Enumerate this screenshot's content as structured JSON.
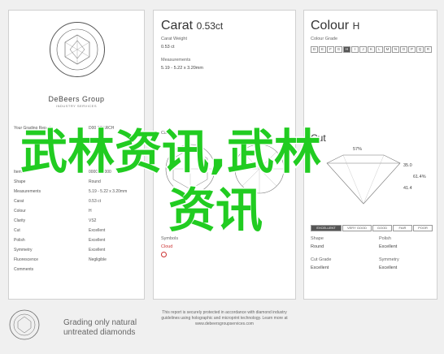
{
  "left": {
    "brand": "DeBeers Group",
    "brand_sub": "INDUSTRY SERVICES",
    "report_header_label": "Your Grading Report",
    "report_header_value": "D00 SEARCH",
    "fields": [
      {
        "label": "Item",
        "value": "0000000000"
      },
      {
        "label": "Shape",
        "value": "Round"
      },
      {
        "label": "Measurements",
        "value": "5.19 - 5.22 x 3.20mm"
      },
      {
        "label": "Carat",
        "value": "0.53 ct"
      },
      {
        "label": "Colour",
        "value": "H"
      },
      {
        "label": "Clarity",
        "value": "VS2"
      },
      {
        "label": "Cut",
        "value": "Excellent"
      },
      {
        "label": "Polish",
        "value": "Excellent"
      },
      {
        "label": "Symmetry",
        "value": "Excellent"
      },
      {
        "label": "Fluorescence",
        "value": "Negligible"
      },
      {
        "label": "Comments",
        "value": ""
      }
    ],
    "footer_line1": "Grading only natural",
    "footer_line2": "untreated diamonds"
  },
  "mid": {
    "title": "Carat",
    "title_value": "0.53ct",
    "carat_weight_label": "Carat Weight",
    "carat_weight_value": "0.53 ct",
    "measurements_label": "Measurements",
    "measurements_value": "5.19 - 5.22 x 3.20mm",
    "clarity_label": "Clarity",
    "clarity_value": "VS2",
    "symbols_label": "Symbols",
    "symbols_value": "Cloud",
    "footer_text": "This report is securely protected in accordance with diamond industry guidelines using holographic and microprint technology. Learn more at www.debeersgroupservices.com"
  },
  "right": {
    "title": "Colour",
    "title_value": "H",
    "scale_label": "Colour Grade",
    "scale": [
      "D",
      "E",
      "F",
      "G",
      "H",
      "I",
      "J",
      "K",
      "L",
      "M",
      "N",
      "O",
      "P",
      "Q",
      "R",
      "S",
      "T",
      "U",
      "V",
      "W",
      "X",
      "Y",
      "Z"
    ],
    "scale_visible": [
      "D",
      "E",
      "F",
      "G",
      "H",
      "I",
      "J"
    ],
    "scale_selected": "H",
    "scale_row2": [
      "K",
      "L",
      "M",
      "N",
      "O",
      "P",
      "Q",
      "R",
      "S",
      "T",
      "U",
      "V"
    ],
    "cut_title": "Cut",
    "cut_value": "Excellent",
    "cut_scale": [
      "EXCELLENT",
      "VERY GOOD",
      "GOOD",
      "FAIR",
      "POOR"
    ],
    "cut_selected": "EXCELLENT",
    "shape_label": "Shape",
    "shape_value": "Round",
    "polish_label": "Polish",
    "polish_value": "Excellent",
    "cutgrade_label": "Cut Grade",
    "cutgrade_value": "Excellent",
    "symmetry_label": "Symmetry",
    "symmetry_value": "Excellent",
    "proportions": [
      "57%",
      "35.0",
      "61.4%",
      "41.4"
    ]
  },
  "watermark": {
    "line1": "武林资讯,武林",
    "line2": "资讯"
  },
  "colors": {
    "watermark": "#21cc21",
    "panel_border": "#d0d0d0"
  }
}
